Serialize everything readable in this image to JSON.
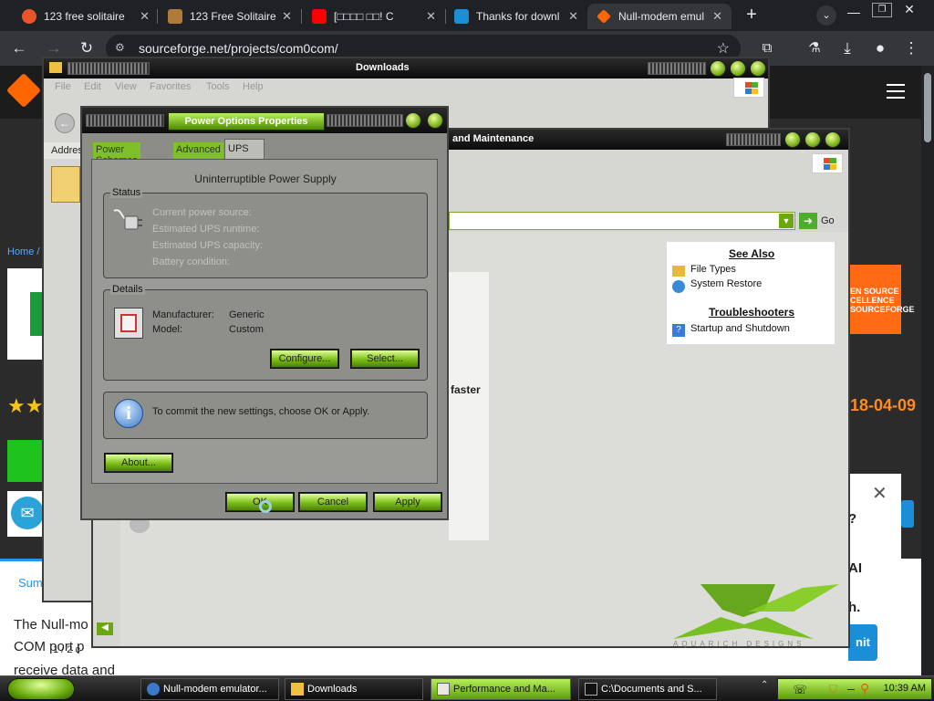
{
  "browser": {
    "tabs": [
      {
        "label": "123 free solitaire",
        "fav_color": "#e8552a"
      },
      {
        "label": "123 Free Solitaire",
        "fav_color": "#b07a3a"
      },
      {
        "label": "[□□□□ □□! C",
        "fav_color": "#ff0000"
      },
      {
        "label": "Thanks for downl",
        "fav_color": "#1a8fd8"
      },
      {
        "label": "Null-modem emul",
        "fav_color": "#ff6600"
      }
    ],
    "new_tab": "+",
    "url": "sourceforge.net/projects/com0com/"
  },
  "sf_page": {
    "breadcrumb": "Home /",
    "date": "18-04-09",
    "badge_text": "EN SOURCE CELLENCE SOURCEFORGE",
    "summary_tab": "Sum",
    "para1": "The Null-mo",
    "para2": "COM port p",
    "para3": "receive data and",
    "ad_line1": "?",
    "ad_line2": "AI",
    "ad_line3": "h.",
    "ad_button": "nit",
    "faster": "faster"
  },
  "downloads_window": {
    "title": "Downloads",
    "menu": [
      "File",
      "Edit",
      "View",
      "Favorites",
      "Tools",
      "Help"
    ],
    "address_label": "Addres",
    "status": "1 / 2 c"
  },
  "perf_window": {
    "title": "and Maintenance",
    "go_label": "Go",
    "see_also_title": "See Also",
    "see_also_items": [
      "File Types",
      "System Restore"
    ],
    "troubleshooters_title": "Troubleshooters",
    "troubleshooters_items": [
      "Startup and Shutdown"
    ]
  },
  "power_dialog": {
    "title": "Power Options Properties",
    "tabs": [
      "Power Schemes",
      "Advanced",
      "UPS"
    ],
    "heading": "Uninterruptible Power Supply",
    "status_group": "Status",
    "status_rows": [
      "Current power source:",
      "Estimated UPS runtime:",
      "Estimated UPS capacity:",
      "Battery condition:"
    ],
    "details_group": "Details",
    "manufacturer_label": "Manufacturer:",
    "manufacturer_value": "Generic",
    "model_label": "Model:",
    "model_value": "Custom",
    "configure_btn": "Configure...",
    "select_btn": "Select...",
    "info_text": "To commit the new settings, choose OK or Apply.",
    "about_btn": "About...",
    "ok_btn": "OK",
    "cancel_btn": "Cancel",
    "apply_btn": "Apply"
  },
  "watermark": "AQUARICH DESIGNS",
  "taskbar": {
    "items": [
      {
        "label": "Null-modem emulator...",
        "active": false
      },
      {
        "label": "Downloads",
        "active": false
      },
      {
        "label": "Performance and Ma...",
        "active": true
      },
      {
        "label": "C:\\Documents and S...",
        "active": false
      }
    ],
    "clock": "10:39 AM"
  },
  "colors": {
    "xp_green": "#7dbe18",
    "chrome_dark": "#202124",
    "sf_orange": "#ff6600"
  }
}
